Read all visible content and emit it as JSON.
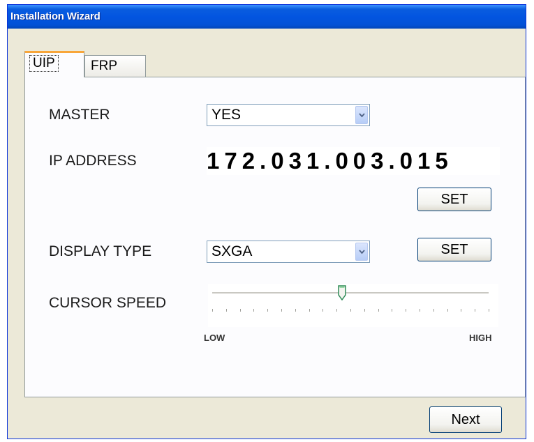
{
  "window": {
    "title": "Installation Wizard"
  },
  "tabs": [
    {
      "label": "UIP",
      "active": true
    },
    {
      "label": "FRP",
      "active": false
    }
  ],
  "form": {
    "master": {
      "label": "MASTER",
      "value": "YES"
    },
    "ip_address": {
      "label": "IP ADDRESS",
      "value": "172.031.003.015",
      "set_label": "SET"
    },
    "display_type": {
      "label": "DISPLAY TYPE",
      "value": "SXGA",
      "set_label": "SET"
    },
    "cursor_speed": {
      "label": "CURSOR SPEED",
      "low_label": "LOW",
      "high_label": "HIGH",
      "level": 0.47,
      "tick_count": 21
    }
  },
  "footer": {
    "next_label": "Next"
  },
  "colors": {
    "title_bar": "#0355e0",
    "window_bg": "#ece9d8",
    "active_tab_accent": "#f8a63a",
    "button_border": "#003c74"
  },
  "icons": {
    "combo_arrow": "chevron-down-icon",
    "slider_thumb": "slider-thumb-icon"
  }
}
